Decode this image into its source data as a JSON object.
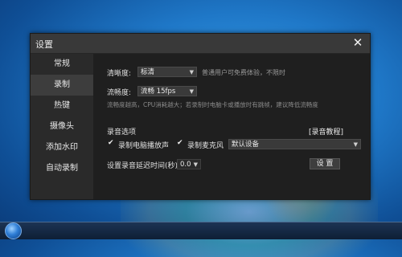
{
  "dialog": {
    "title": "设置",
    "close_glyph": "✕"
  },
  "nav": {
    "items": [
      "常规",
      "录制",
      "热键",
      "摄像头",
      "添加水印",
      "自动录制"
    ],
    "active_index": 1
  },
  "record": {
    "clarity_label": "清晰度:",
    "clarity_value": "标清",
    "clarity_hint": "普通用户可免费体验，不限时",
    "fluency_label": "流畅度:",
    "fluency_value": "流畅 15fps",
    "fluency_hint": "流畅度越高，CPU消耗越大；若录制时电脑卡或播放时有跳帧，建议降低流畅度",
    "audio_section_label": "录音选项",
    "audio_tutorial_link": "[录音教程]",
    "record_speaker_label": "录制电脑播放声",
    "record_mic_label": "录制麦克风",
    "mic_device_value": "默认设备",
    "delay_label": "设置录音延迟时间(秒):",
    "delay_value": "0.0",
    "set_button": "设 置",
    "dropdown_arrow": "▼",
    "checkmark": "✔"
  }
}
